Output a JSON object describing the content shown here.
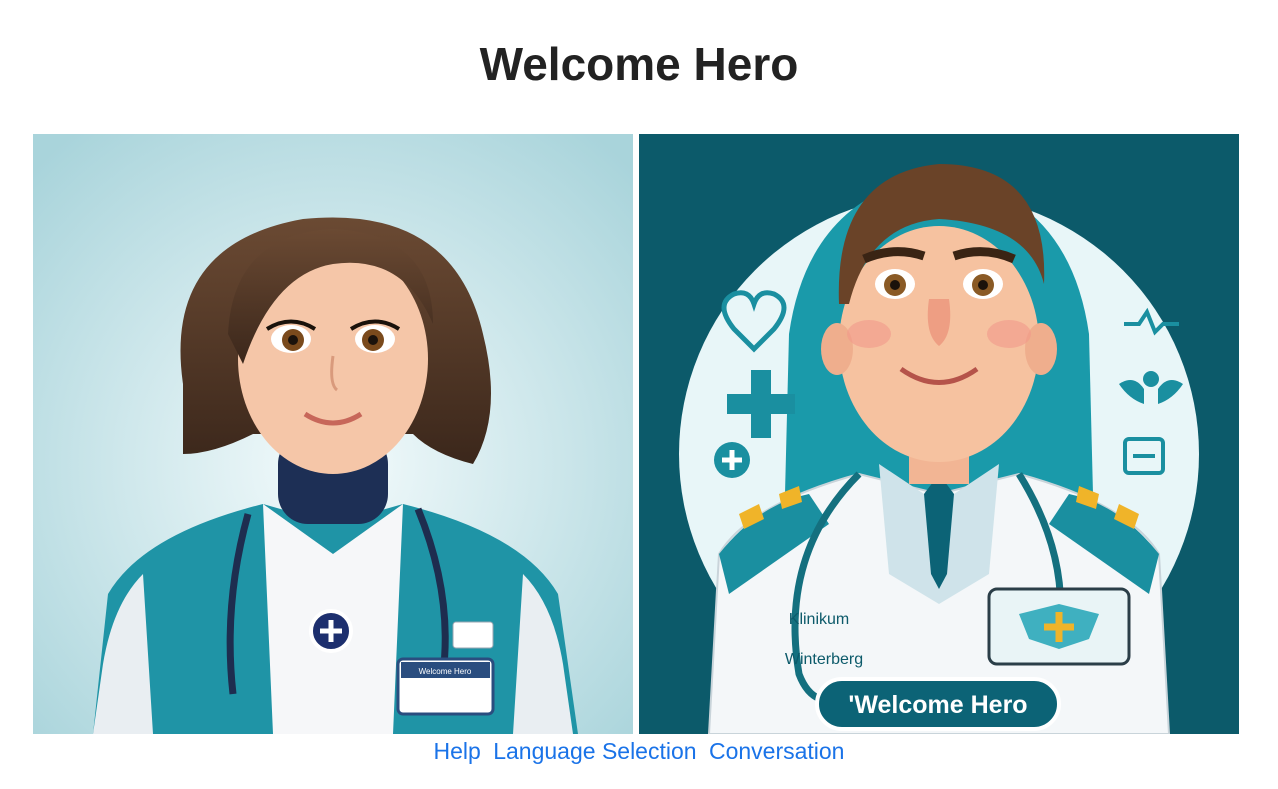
{
  "page": {
    "title": "Welcome Hero"
  },
  "avatars": [
    {
      "id": "female-nurse",
      "badge_text": "Welcome Hero"
    },
    {
      "id": "male-doctor",
      "coat_text_line1": "Klinikum",
      "coat_text_line2": "Winterberg",
      "banner_text": "'Welcome Hero"
    }
  ],
  "nav": {
    "links": [
      {
        "label": "Help"
      },
      {
        "label": "Language Selection"
      },
      {
        "label": "Conversation"
      }
    ]
  },
  "colors": {
    "title": "#222222",
    "link": "#1a73e8",
    "teal": "#1a8fa0",
    "dark_teal": "#0a5d6e"
  }
}
